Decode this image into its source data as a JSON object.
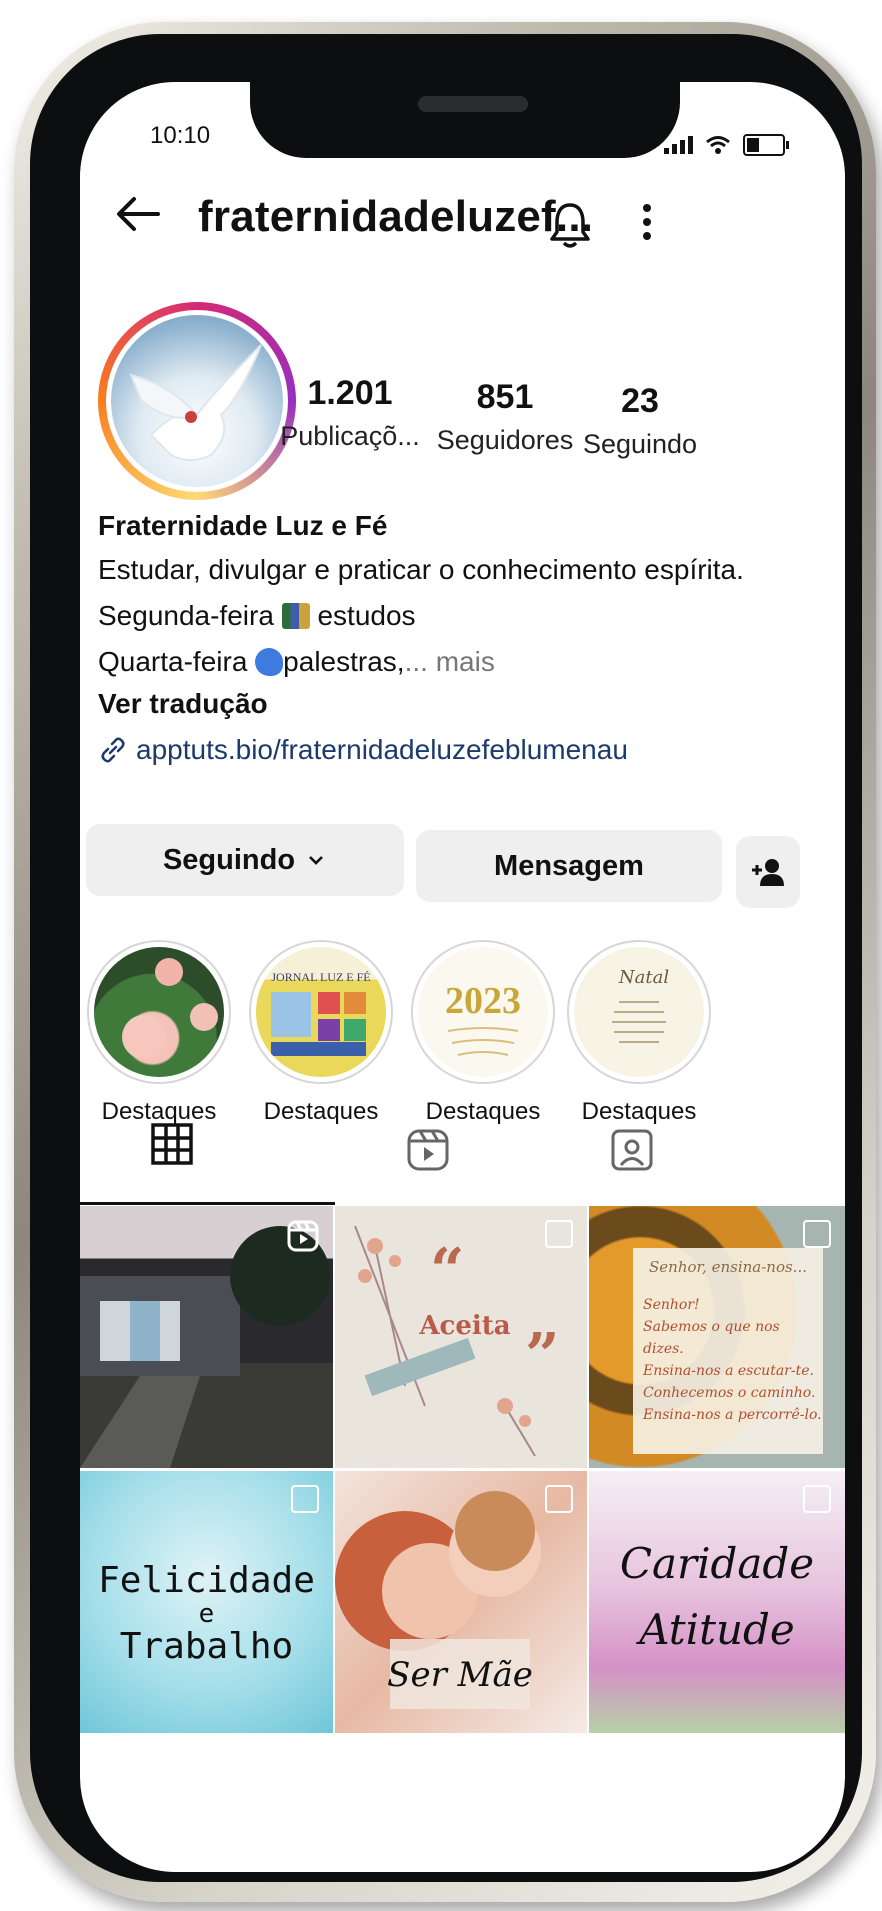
{
  "status": {
    "time": "10:10"
  },
  "header": {
    "username": "fraternidadeluzef..."
  },
  "stats": [
    {
      "value": "1.201",
      "label": "Publicaçõ..."
    },
    {
      "value": "851",
      "label": "Seguidores"
    },
    {
      "value": "23",
      "label": "Seguindo"
    }
  ],
  "bio": {
    "name": "Fraternidade Luz e Fé",
    "line1": "Estudar, divulgar e praticar o conhecimento espírita.",
    "line2_pre": "Segunda-feira ",
    "line2_post": " estudos",
    "line3_pre": "Quarta-feira ",
    "line3_post": "palestras,",
    "line3_more": "... mais",
    "translate": "Ver tradução",
    "link": "apptuts.bio/fraternidadeluzefeblumenau"
  },
  "buttons": {
    "following": "Seguindo",
    "message": "Mensagem"
  },
  "highlights": [
    {
      "label": "Destaques",
      "text": ""
    },
    {
      "label": "Destaques",
      "text": "JORNAL LUZ E FÉ"
    },
    {
      "label": "Destaques",
      "text": "2023"
    },
    {
      "label": "Destaques",
      "text": "Natal"
    }
  ],
  "posts": [
    {
      "text": ""
    },
    {
      "text": "Aceita"
    },
    {
      "title": "Senhor, ensina-nos...",
      "lines": [
        "Senhor!",
        "Sabemos o que nos dizes.",
        "Ensina-nos a escutar-te.",
        "Conhecemos o caminho.",
        "Ensina-nos a percorrê-lo."
      ]
    },
    {
      "line1": "Felicidade",
      "line2": "e",
      "line3": "Trabalho"
    },
    {
      "text": "Ser Mãe"
    },
    {
      "line1": "Caridade",
      "line2": "Atitude"
    }
  ],
  "colors": {
    "link": "#1c3a6b",
    "button_bg": "#efefef"
  }
}
